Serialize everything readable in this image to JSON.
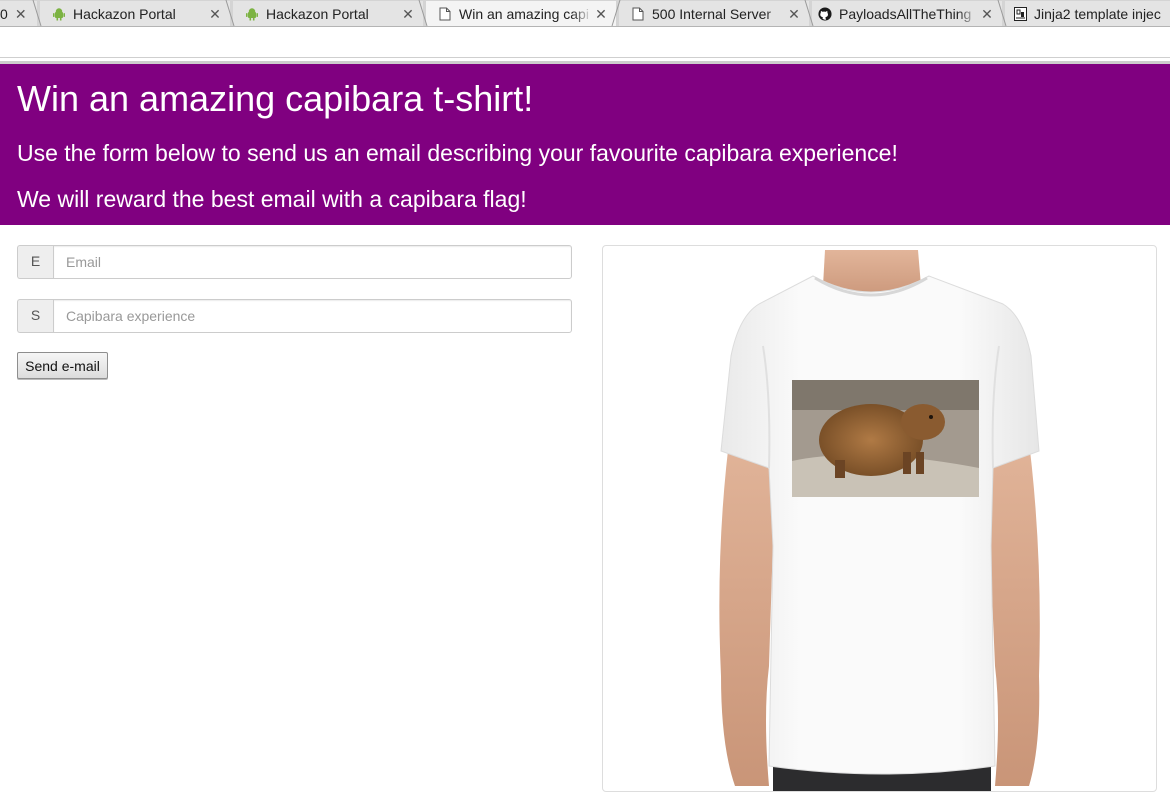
{
  "browser": {
    "tabs": [
      {
        "title": "0",
        "favicon": "page-icon",
        "active": false
      },
      {
        "title": "Hackazon Portal",
        "favicon": "android-icon",
        "active": false
      },
      {
        "title": "Hackazon Portal",
        "favicon": "android-icon",
        "active": false
      },
      {
        "title": "Win an amazing capi",
        "favicon": "page-icon",
        "active": true
      },
      {
        "title": "500 Internal Server",
        "favicon": "page-icon",
        "active": false
      },
      {
        "title": "PayloadsAllTheThing",
        "favicon": "github-icon",
        "active": false
      },
      {
        "title": "Jinja2 template injec",
        "favicon": "document-icon",
        "active": false
      }
    ],
    "close_glyph": "✕"
  },
  "hero": {
    "title": "Win an amazing capibara t-shirt!",
    "line1": "Use the form below to send us an email describing your favourite capibara experience!",
    "line2": "We will reward the best email with a capibara flag!",
    "background": "#800080"
  },
  "form": {
    "email_addon": "E",
    "email_placeholder": "Email",
    "experience_addon": "S",
    "experience_placeholder": "Capibara experience",
    "send_label": "Send e-mail"
  },
  "image": {
    "subject": "white t-shirt with capybara photo print"
  }
}
